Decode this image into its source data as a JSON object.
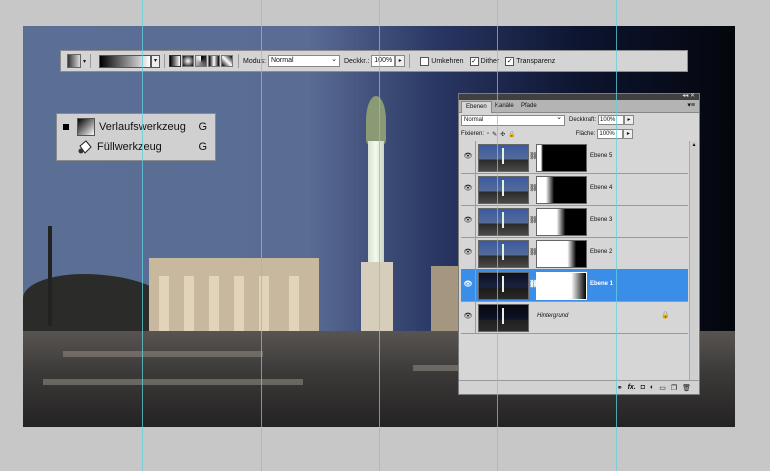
{
  "options_bar": {
    "mode_label": "Modus:",
    "mode_value": "Normal",
    "opacity_label": "Deckkr.:",
    "opacity_value": "100%",
    "reverse_label": "Umkehren",
    "reverse_checked": false,
    "dither_label": "Dither",
    "dither_checked": true,
    "transparency_label": "Transparenz",
    "transparency_checked": true,
    "gradient_types": [
      "linear-gradient-icon",
      "radial-gradient-icon",
      "angle-gradient-icon",
      "reflected-gradient-icon",
      "diamond-gradient-icon"
    ]
  },
  "tool_flyout": {
    "items": [
      {
        "label": "Verlaufswerkzeug",
        "shortcut": "G",
        "active": true,
        "icon": "gradient-tool-icon"
      },
      {
        "label": "Füllwerkzeug",
        "shortcut": "G",
        "active": false,
        "icon": "paint-bucket-icon"
      }
    ]
  },
  "layers_panel": {
    "tabs": [
      "Ebenen",
      "Kanäle",
      "Pfade"
    ],
    "active_tab": "Ebenen",
    "blend_mode": "Normal",
    "opacity_label": "Deckkraft:",
    "opacity_value": "100%",
    "lock_label": "Fixieren:",
    "fill_label": "Fläche:",
    "fill_value": "100%",
    "layers": [
      {
        "name": "Ebene 5",
        "selected": false
      },
      {
        "name": "Ebene 4",
        "selected": false
      },
      {
        "name": "Ebene 3",
        "selected": false
      },
      {
        "name": "Ebene 2",
        "selected": false
      },
      {
        "name": "Ebene 1",
        "selected": true
      },
      {
        "name": "Hintergrund",
        "selected": false
      }
    ],
    "selected_color": "#3a8ee8"
  }
}
